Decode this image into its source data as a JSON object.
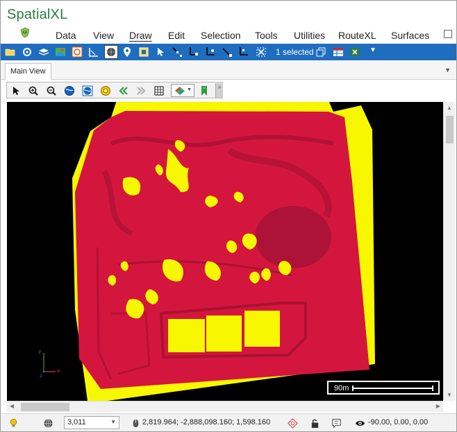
{
  "app": {
    "title": "SpatialXL"
  },
  "menu": {
    "items": [
      "Data",
      "View",
      "Draw",
      "Edit",
      "Selection",
      "Tools",
      "Utilities",
      "RouteXL",
      "Surfaces"
    ],
    "active": "Draw"
  },
  "ribbon": {
    "selected_label": "1 selected",
    "icons": [
      "open-folder-icon",
      "settings-gear-icon",
      "layers-icon",
      "map-pin-icon",
      "lasso-icon",
      "measure-icon",
      "globe-icon",
      "location-pin-icon",
      "frame-icon",
      "pointer-icon",
      "node-edit-icon",
      "node-add-icon",
      "node-move-icon",
      "node-delete-icon",
      "clear-selection-icon",
      "copy-to-sheet-icon",
      "table-view-icon",
      "excel-export-icon"
    ]
  },
  "tabs": {
    "main_view": "Main View"
  },
  "map_toolbar": {
    "icons": [
      "select-arrow-icon",
      "zoom-in-icon",
      "zoom-out-icon",
      "globe-extent-icon",
      "globe-full-icon",
      "sun-icon",
      "back-icon",
      "forward-icon",
      "grid-icon",
      "render-style-icon",
      "bookmark-icon"
    ]
  },
  "map": {
    "scale_label": "90m",
    "axis_labels": {
      "x": "x",
      "y": "y",
      "z": "z"
    },
    "colors": {
      "background": "#000000",
      "surface": "#d4163f",
      "base": "#f7f700"
    }
  },
  "status": {
    "point_count": "3,011",
    "coordinates": "2,819.964; -2,888,098.160; 1,598.160",
    "view_angles": "-90.00, 0.00, 0.00"
  }
}
